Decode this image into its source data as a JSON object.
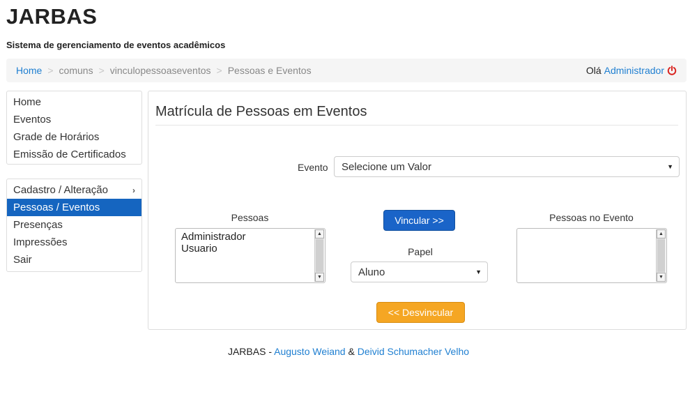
{
  "app": {
    "title": "JARBAS",
    "subtitle": "Sistema de gerenciamento de eventos acadêmicos"
  },
  "breadcrumb": {
    "items": [
      "Home",
      "comuns",
      "vinculopessoaseventos",
      "Pessoas e Eventos"
    ],
    "separator": ">"
  },
  "header": {
    "greeting": "Olá",
    "user": "Administrador",
    "logout_icon": "power-icon"
  },
  "sidebar": {
    "menu1": [
      "Home",
      "Eventos",
      "Grade de Horários",
      "Emissão de Certificados"
    ],
    "menu2": [
      "Cadastro / Alteração",
      "Pessoas / Eventos",
      "Presenças",
      "Impressões",
      "Sair"
    ],
    "menu2_active": "Pessoas / Eventos",
    "submenu_icon": "chevron-right-icon"
  },
  "main": {
    "title": "Matrícula de Pessoas em Eventos",
    "evento_label": "Evento",
    "evento_value": "Selecione um Valor",
    "pessoas_label": "Pessoas",
    "pessoas": [
      "Administrador",
      "Usuario"
    ],
    "pessoas_no_evento_label": "Pessoas no Evento",
    "pessoas_no_evento": [],
    "vincular": "Vincular >>",
    "papel_label": "Papel",
    "papel_value": "Aluno",
    "desvincular": "<< Desvincular"
  },
  "footer": {
    "prefix": "JARBAS -",
    "author1": "Augusto Weiand",
    "and": "&",
    "author2": "Deivid Schumacher Velho"
  },
  "colors": {
    "link": "#1f7fd1",
    "active_nav": "#1565c0",
    "primary_button": "#1a64c8",
    "warning_button": "#f5a623",
    "logout_icon": "#d9231f"
  }
}
